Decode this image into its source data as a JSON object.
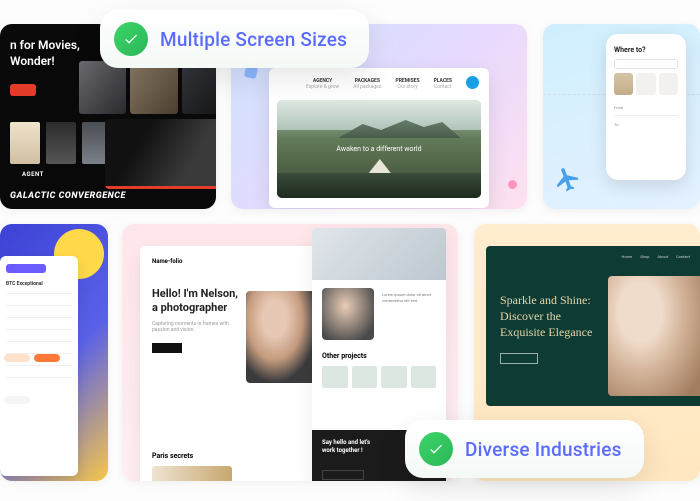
{
  "badges": {
    "top": "Multiple Screen Sizes",
    "bottom": "Diverse Industries"
  },
  "cards": {
    "movies": {
      "title_line1": "n for Movies,",
      "title_line2": "Wonder!",
      "agent_label": "AGENT",
      "banner_title": "GALACTIC CONVERGENCE"
    },
    "travel": {
      "tabs": [
        {
          "t": "AGENCY",
          "s": "Explore & grow"
        },
        {
          "t": "PACKAGES",
          "s": "All packages"
        },
        {
          "t": "PREMISES",
          "s": "Our story"
        },
        {
          "t": "PLACES",
          "s": "Contact"
        }
      ],
      "hero_text": "Awaken to a different world"
    },
    "mobile": {
      "heading": "Where to?",
      "labels": [
        "From",
        "To"
      ]
    },
    "dashboard": {
      "heading": "BTC  Exceptional"
    },
    "portfolio": {
      "brand": "Name-folio",
      "headline": "Hello! I'm Nelson, a photographer",
      "subtitle": "Capturing moments in frames with passion and vision.",
      "section1": "Paris secrets",
      "section2": "Other projects",
      "footer_cta": "Say hello and let's work together !"
    },
    "jewelry": {
      "nav": [
        "Home",
        "Shop",
        "About",
        "Contact"
      ],
      "headline": "Sparkle and Shine: Discover the Exquisite Elegance"
    }
  }
}
